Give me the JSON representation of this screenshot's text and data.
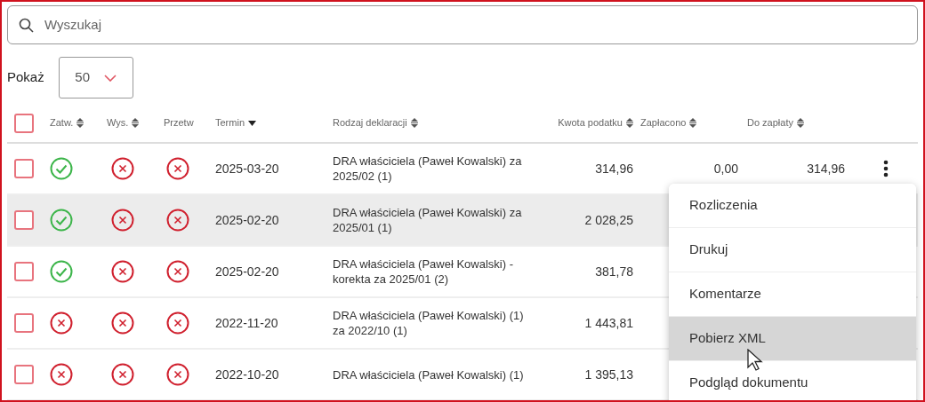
{
  "search": {
    "placeholder": "Wyszukaj"
  },
  "page_size": {
    "label": "Pokaż",
    "value": "50"
  },
  "table": {
    "select_all": {
      "checked": false
    },
    "columns": [
      {
        "label": "Zatw.",
        "sortable": true,
        "sorted": false
      },
      {
        "label": "Wys.",
        "sortable": true,
        "sorted": false
      },
      {
        "label": "Przetw",
        "sortable": false,
        "sorted": false
      },
      {
        "label": "Termin",
        "sortable": true,
        "sorted": true
      },
      {
        "label": "Rodzaj deklaracji",
        "sortable": true,
        "sorted": false
      },
      {
        "label": "Kwota podatku",
        "sortable": true,
        "sorted": false
      },
      {
        "label": "Zapłacono",
        "sortable": true,
        "sorted": false
      },
      {
        "label": "Do zapłaty",
        "sortable": true,
        "sorted": false
      }
    ],
    "rows": [
      {
        "checked": false,
        "hovered": false,
        "approved": true,
        "sent": false,
        "processed": false,
        "deadline": "2025-03-20",
        "type": "DRA właściciela (Paweł Kowalski) za 2025/02 (1)",
        "tax": "314,96",
        "paid": "0,00",
        "due": "314,96"
      },
      {
        "checked": false,
        "hovered": true,
        "approved": true,
        "sent": false,
        "processed": false,
        "deadline": "2025-02-20",
        "type": "DRA właściciela (Paweł Kowalski) za 2025/01 (1)",
        "tax": "2 028,25"
      },
      {
        "checked": false,
        "hovered": false,
        "approved": true,
        "sent": false,
        "processed": false,
        "deadline": "2025-02-20",
        "type": "DRA właściciela (Paweł Kowalski) - korekta za 2025/01 (2)",
        "tax": "381,78"
      },
      {
        "checked": false,
        "hovered": false,
        "approved": false,
        "sent": false,
        "processed": false,
        "deadline": "2022-11-20",
        "type": "DRA właściciela (Paweł Kowalski) (1) za 2022/10 (1)",
        "tax": "1 443,81"
      },
      {
        "checked": false,
        "hovered": false,
        "approved": false,
        "sent": false,
        "processed": false,
        "deadline": "2022-10-20",
        "type": "DRA właściciela (Paweł Kowalski) (1)",
        "tax": "1 395,13"
      }
    ]
  },
  "context_menu": {
    "items": [
      {
        "label": "Rozliczenia",
        "selected": false
      },
      {
        "label": "Drukuj",
        "selected": false
      },
      {
        "label": "Komentarze",
        "selected": false
      },
      {
        "label": "Pobierz XML",
        "selected": true
      },
      {
        "label": "Podgląd dokumentu",
        "selected": false
      }
    ]
  }
}
